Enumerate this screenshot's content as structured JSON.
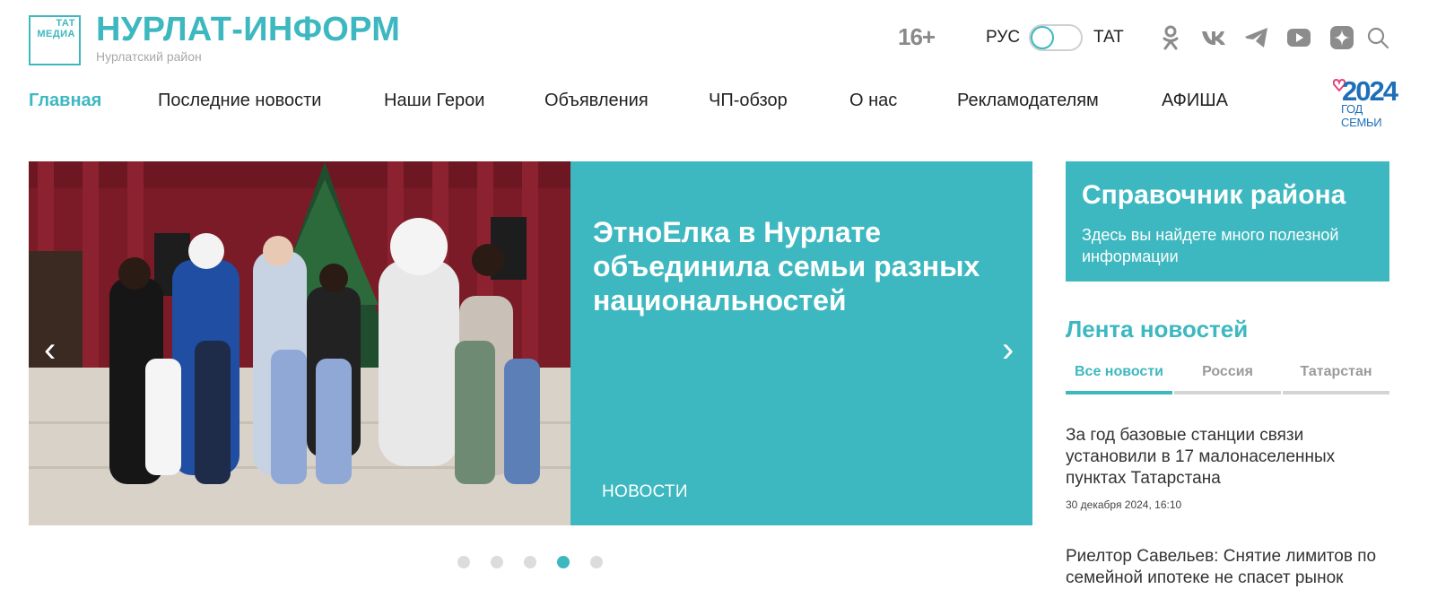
{
  "header": {
    "logo_line1": "ТАТ",
    "logo_line2": "МЕДИА",
    "title": "НУРЛАТ-ИНФОРМ",
    "subtitle": "Нурлатский район",
    "age_rating": "16+",
    "lang_ru": "РУС",
    "lang_tat": "ТАТ",
    "social_icons": [
      "odnoklassniki-icon",
      "vk-icon",
      "telegram-icon",
      "youtube-icon",
      "dzen-icon",
      "search-icon"
    ]
  },
  "nav": {
    "items": [
      {
        "label": "Главная",
        "active": true
      },
      {
        "label": "Последние новости"
      },
      {
        "label": "Наши Герои"
      },
      {
        "label": "Объявления"
      },
      {
        "label": "ЧП-обзор"
      },
      {
        "label": "О нас"
      },
      {
        "label": "Рекламодателям"
      },
      {
        "label": "АФИША"
      }
    ],
    "year_logo_num": "2024",
    "year_logo_text": "ГОД СЕМЬИ"
  },
  "slider": {
    "title": "ЭтноЕлка в Нурлате объединила семьи разных национальностей",
    "tag": "НОВОСТИ",
    "prev": "‹",
    "next": "›",
    "dots_count": 5,
    "active_dot": 4
  },
  "promo": {
    "title": "Справочник района",
    "text": "Здесь вы найдете много полезной информации"
  },
  "feed": {
    "title": "Лента новостей",
    "tabs": [
      {
        "label": "Все новости",
        "active": true
      },
      {
        "label": "Россия"
      },
      {
        "label": "Татарстан"
      }
    ],
    "items": [
      {
        "title": "За год базовые станции связи установили в 17 малонаселенных пунктах Татарстана",
        "date": "30 декабря 2024, 16:10"
      },
      {
        "title": "Риелтор Савельев: Снятие лимитов по семейной ипотеке не спасет рынок",
        "date": ""
      }
    ]
  },
  "colors": {
    "accent": "#3eb8c0",
    "year_logo_blue": "#1f6fb8",
    "heart_pink": "#e8417a"
  }
}
